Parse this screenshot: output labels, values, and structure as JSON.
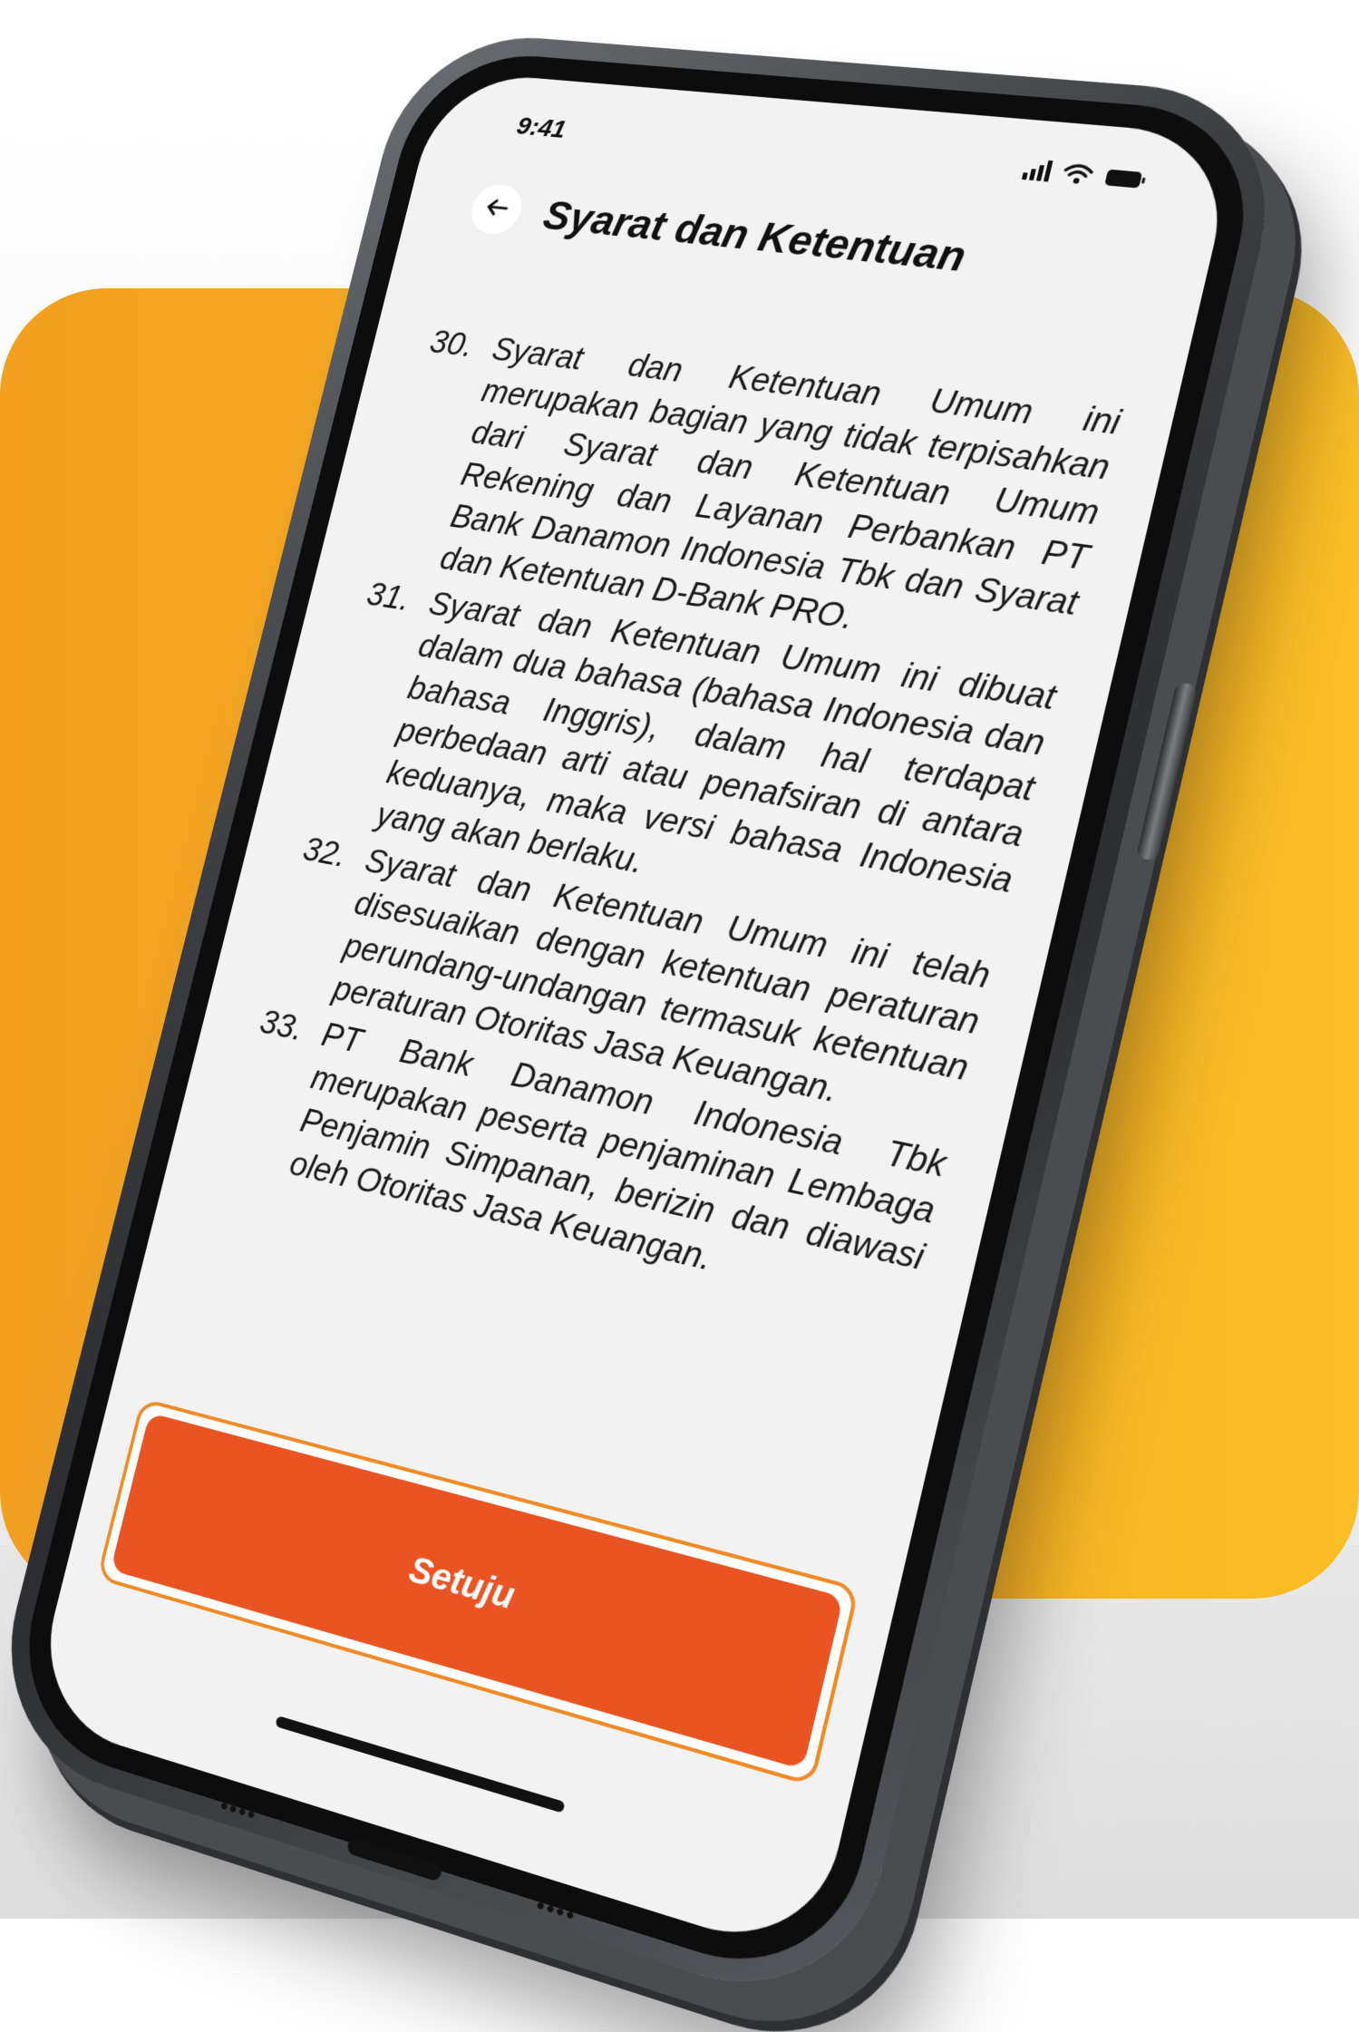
{
  "status_bar": {
    "time": "9:41"
  },
  "header": {
    "title": "Syarat dan Ketentuan"
  },
  "terms": [
    {
      "number": "30.",
      "text": "Syarat dan Ketentuan Umum ini merupakan bagian yang tidak terpisahkan dari Syarat dan Ketentuan Umum Rekening dan Layanan Perbankan PT Bank Danamon Indonesia Tbk dan Syarat dan Ketentuan D-Bank PRO."
    },
    {
      "number": "31.",
      "text": "Syarat dan Ketentuan Umum ini dibuat dalam dua bahasa (bahasa Indonesia dan bahasa Inggris), dalam hal terdapat perbedaan arti atau penafsiran di antara keduanya, maka versi bahasa Indonesia yang akan berlaku."
    },
    {
      "number": "32.",
      "text": "Syarat dan Ketentuan Umum ini telah disesuaikan dengan ketentuan peraturan perundang-undangan termasuk ketentuan peraturan Otoritas Jasa Keuangan."
    },
    {
      "number": "33.",
      "text": "PT Bank Danamon Indonesia Tbk merupakan peserta penjaminan Lembaga Penjamin Simpanan, berizin dan diawasi oleh Otoritas Jasa Keuangan."
    }
  ],
  "agree_button": {
    "label": "Setuju"
  },
  "icons": {
    "back": "arrow-left-icon",
    "signal": "signal-icon",
    "wifi": "wifi-icon",
    "battery": "battery-icon"
  },
  "colors": {
    "backdrop_start": "#f3a021",
    "backdrop_end": "#fbbe26",
    "button": "#ea5322",
    "button_outline": "#f08a24",
    "screen_background": "#f2f2f2"
  }
}
